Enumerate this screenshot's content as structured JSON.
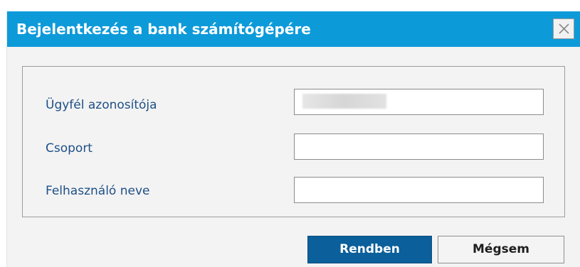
{
  "dialog": {
    "title": "Bejelentkezés a bank számítógépére"
  },
  "form": {
    "fields": [
      {
        "label": "Ügyfél azonosítója",
        "value": ""
      },
      {
        "label": "Csoport",
        "value": ""
      },
      {
        "label": "Felhasználó neve",
        "value": ""
      }
    ]
  },
  "buttons": {
    "ok_label": "Rendben",
    "cancel_label": "Mégsem"
  },
  "icons": {
    "close": "close-icon"
  },
  "colors": {
    "titlebar": "#0d9ad9",
    "label_text": "#1d4f86",
    "primary_button": "#0b5f9a"
  }
}
